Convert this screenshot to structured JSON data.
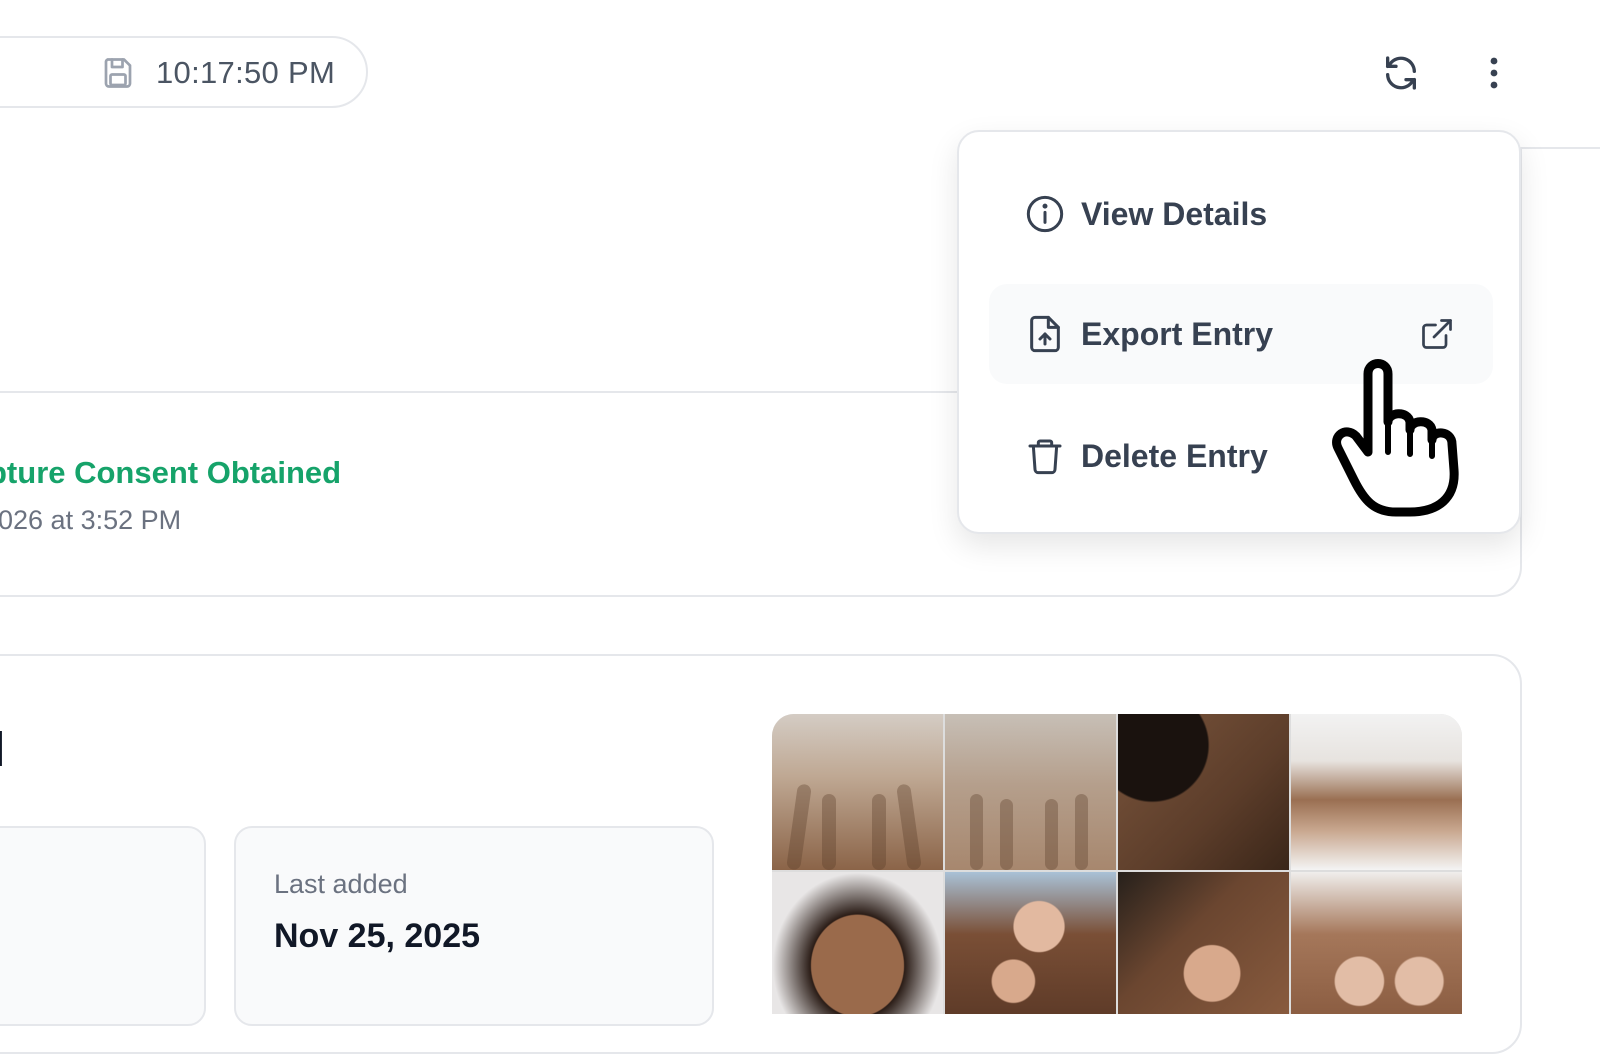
{
  "header": {
    "save_status": {
      "icon": "floppy-disk-icon",
      "time": "10:17:50 PM"
    },
    "refresh": {
      "icon": "refresh-icon"
    },
    "more": {
      "icon": "more-vertical-icon"
    }
  },
  "consent": {
    "title": "pture Consent Obtained",
    "date": "026 at 3:52 PM",
    "color": "#16a36a"
  },
  "photos": {
    "heading": "l",
    "stats": [
      {
        "label": "",
        "value": ""
      },
      {
        "label": "Last added",
        "value": "Nov 25, 2025"
      }
    ],
    "thumbnails": 8
  },
  "menu": {
    "items": [
      {
        "label": "View Details",
        "icon": "info-circle-icon"
      },
      {
        "label": "Export Entry",
        "icon": "file-upload-icon",
        "trailing_icon": "external-link-icon",
        "hovered": true
      },
      {
        "label": "Delete Entry",
        "icon": "trash-icon"
      }
    ]
  },
  "colors": {
    "accent_green": "#16a36a",
    "text_primary": "#111827",
    "text_muted": "#6b7280",
    "border": "#e5e7eb"
  }
}
